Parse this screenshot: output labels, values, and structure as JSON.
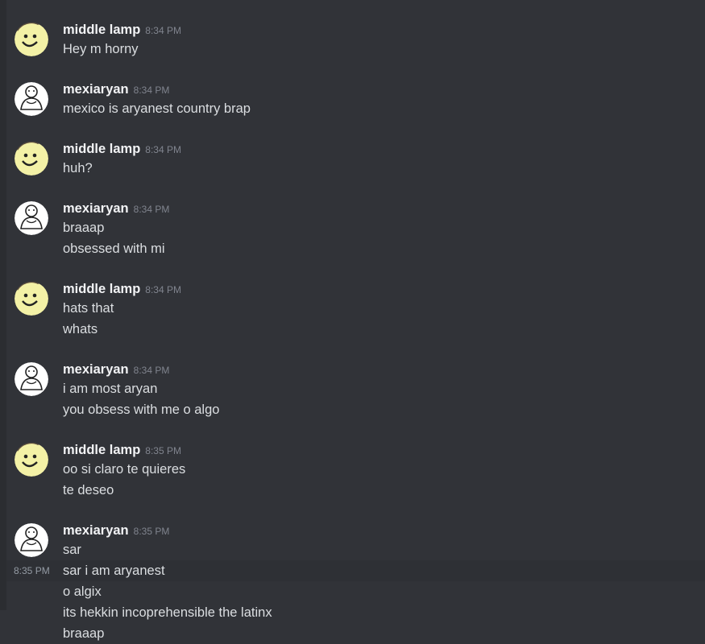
{
  "messages": [
    {
      "author": "middle lamp",
      "time": "8:34 PM",
      "avatar": "smiley-face-icon",
      "lines": [
        "Hey m horny"
      ]
    },
    {
      "author": "mexiaryan",
      "time": "8:34 PM",
      "avatar": "mascot-face-icon",
      "lines": [
        "mexico is aryanest country brap"
      ]
    },
    {
      "author": "middle lamp",
      "time": "8:34 PM",
      "avatar": "smiley-face-icon",
      "lines": [
        "huh?"
      ]
    },
    {
      "author": "mexiaryan",
      "time": "8:34 PM",
      "avatar": "mascot-face-icon",
      "lines": [
        "braaap",
        "obsessed with mi"
      ]
    },
    {
      "author": "middle lamp",
      "time": "8:34 PM",
      "avatar": "smiley-face-icon",
      "lines": [
        "hats that",
        "whats"
      ]
    },
    {
      "author": "mexiaryan",
      "time": "8:34 PM",
      "avatar": "mascot-face-icon",
      "lines": [
        "i am most aryan",
        "you obsess with me o algo"
      ]
    },
    {
      "author": "middle lamp",
      "time": "8:35 PM",
      "avatar": "smiley-face-icon",
      "lines": [
        "oo si claro te quieres",
        "te deseo"
      ]
    },
    {
      "author": "mexiaryan",
      "time": "8:35 PM",
      "avatar": "mascot-face-icon",
      "lines": [
        "sar",
        "sar i am aryanest",
        "o algix",
        "its hekkin incoprehensible the latinx",
        "braaap"
      ],
      "hover_line_time": "8:35 PM"
    }
  ],
  "colors": {
    "background": "#313338",
    "smiley_avatar": "#f3f1a6",
    "mascot_avatar": "#ffffff"
  }
}
